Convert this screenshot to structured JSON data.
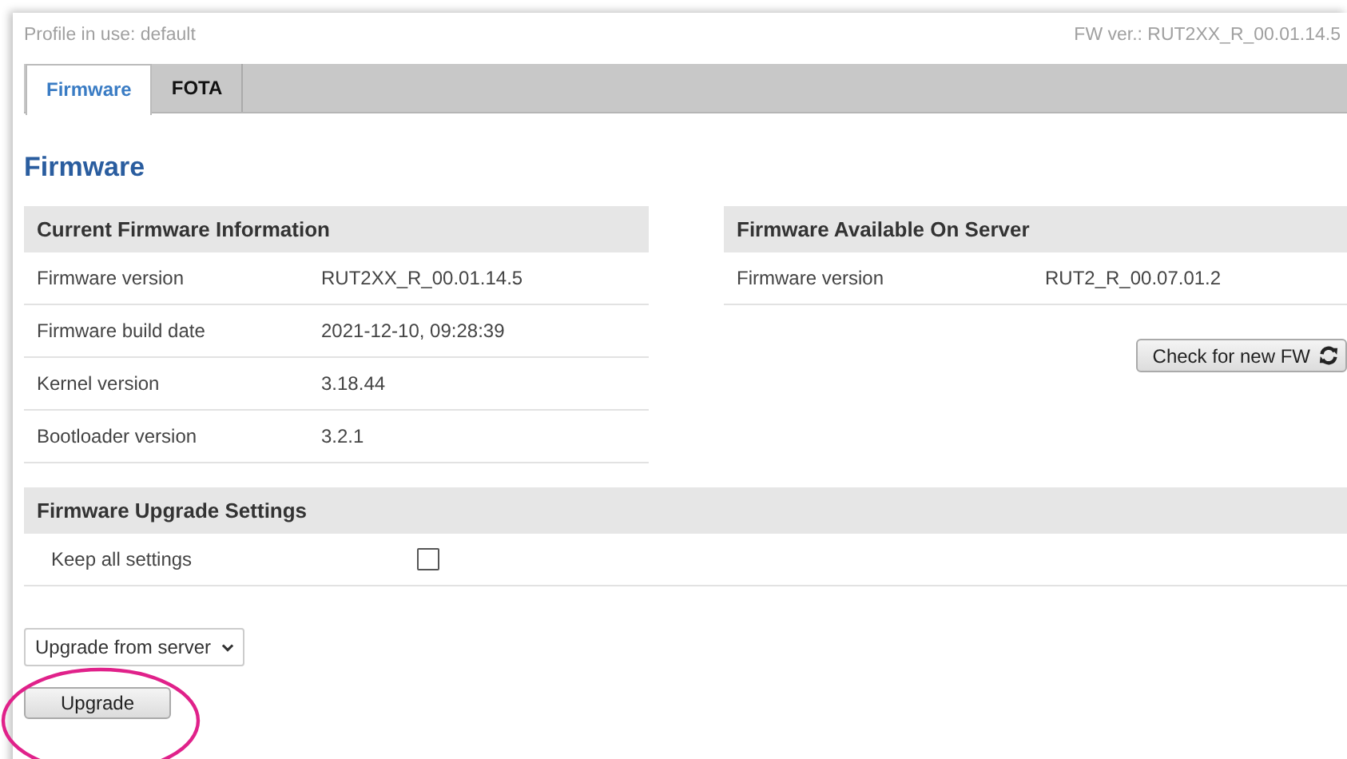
{
  "header": {
    "profile": "Profile in use: default",
    "fw_version": "FW ver.: RUT2XX_R_00.01.14.5"
  },
  "tabs": [
    {
      "label": "Firmware",
      "selected": true
    },
    {
      "label": "FOTA",
      "selected": false
    }
  ],
  "page_title": "Firmware",
  "current_firmware": {
    "title": "Current Firmware Information",
    "rows": [
      {
        "label": "Firmware version",
        "value": "RUT2XX_R_00.01.14.5"
      },
      {
        "label": "Firmware build date",
        "value": "2021-12-10, 09:28:39"
      },
      {
        "label": "Kernel version",
        "value": "3.18.44"
      },
      {
        "label": "Bootloader version",
        "value": "3.2.1"
      }
    ]
  },
  "server_firmware": {
    "title": "Firmware Available On Server",
    "rows": [
      {
        "label": "Firmware version",
        "value": "RUT2_R_00.07.01.2"
      }
    ],
    "check_button": "Check for new FW"
  },
  "upgrade_settings": {
    "title": "Firmware Upgrade Settings",
    "rows": [
      {
        "label": "Keep all settings",
        "checked": false
      }
    ]
  },
  "source_select": {
    "value": "Upgrade from server"
  },
  "upgrade_button": "Upgrade",
  "annotation": {
    "kind": "ellipse",
    "color": "#e0218a"
  }
}
